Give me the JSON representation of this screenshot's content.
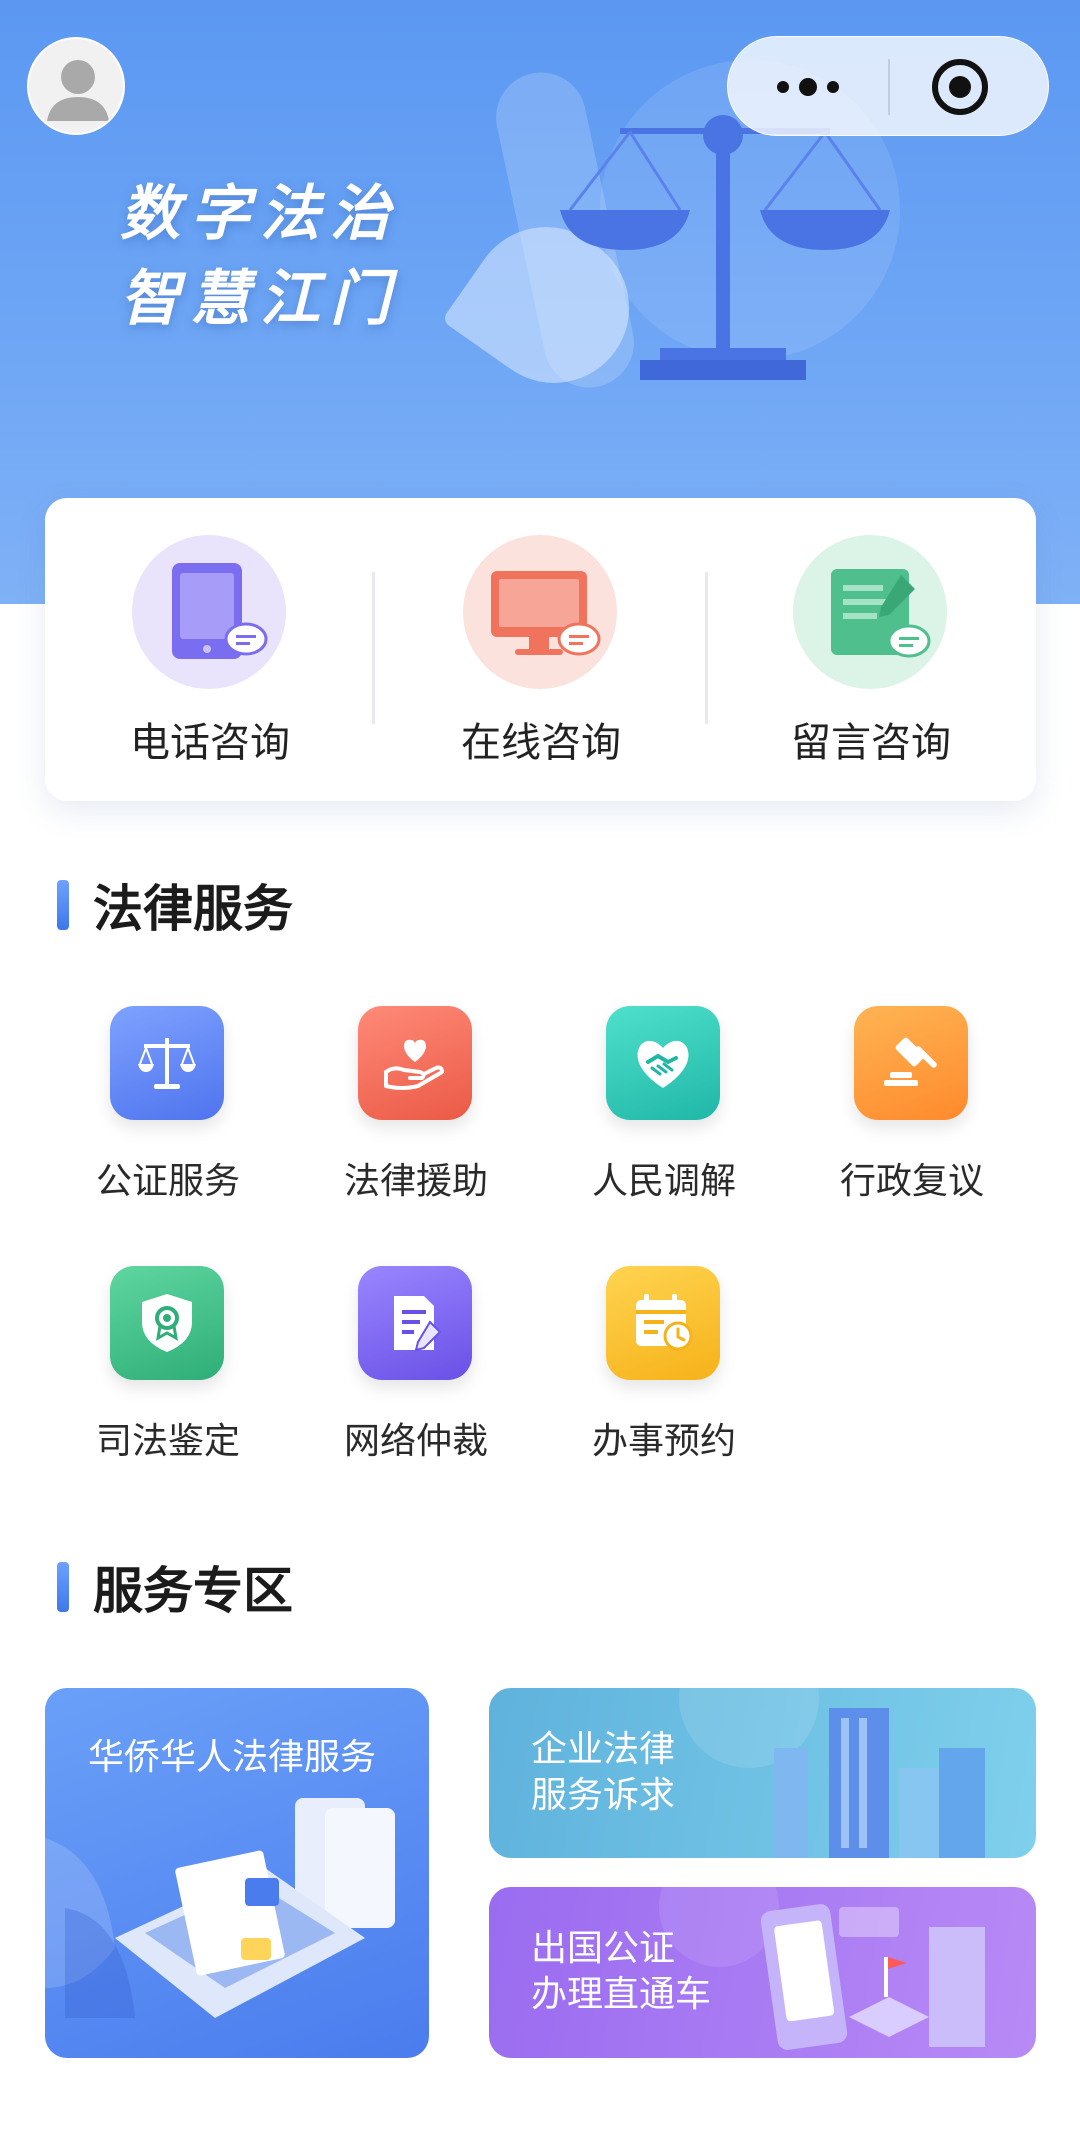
{
  "header": {
    "slogan_line1": "数字法治",
    "slogan_line2": "智慧江门",
    "avatar_icon": "user-avatar-icon",
    "more_icon": "more-dots-icon",
    "close_icon": "target-close-icon"
  },
  "consult": {
    "items": [
      {
        "label": "电话咨询",
        "icon": "tablet-chat-icon",
        "color": "#7b6df0"
      },
      {
        "label": "在线咨询",
        "icon": "monitor-chat-icon",
        "color": "#f0745d"
      },
      {
        "label": "留言咨询",
        "icon": "note-edit-icon",
        "color": "#4fbf8e"
      }
    ]
  },
  "legal_services": {
    "title": "法律服务",
    "items": [
      {
        "label": "公证服务",
        "icon": "scale-icon",
        "color": "#5f86f4"
      },
      {
        "label": "法律援助",
        "icon": "heart-hand-icon",
        "color": "#f26b5b"
      },
      {
        "label": "人民调解",
        "icon": "handshake-icon",
        "color": "#2ec9b6"
      },
      {
        "label": "行政复议",
        "icon": "gavel-icon",
        "color": "#ff9a3c"
      },
      {
        "label": "司法鉴定",
        "icon": "shield-badge-icon",
        "color": "#3dbf8a"
      },
      {
        "label": "网络仲裁",
        "icon": "document-edit-icon",
        "color": "#7a62f0"
      },
      {
        "label": "办事预约",
        "icon": "calendar-clock-icon",
        "color": "#ffc23b"
      }
    ]
  },
  "service_zone": {
    "title": "服务专区",
    "cards": [
      {
        "title": "华侨华人法律服务"
      },
      {
        "title_line1": "企业法律",
        "title_line2": "服务诉求"
      },
      {
        "title_line1": "出国公证",
        "title_line2": "办理直通车"
      }
    ]
  }
}
